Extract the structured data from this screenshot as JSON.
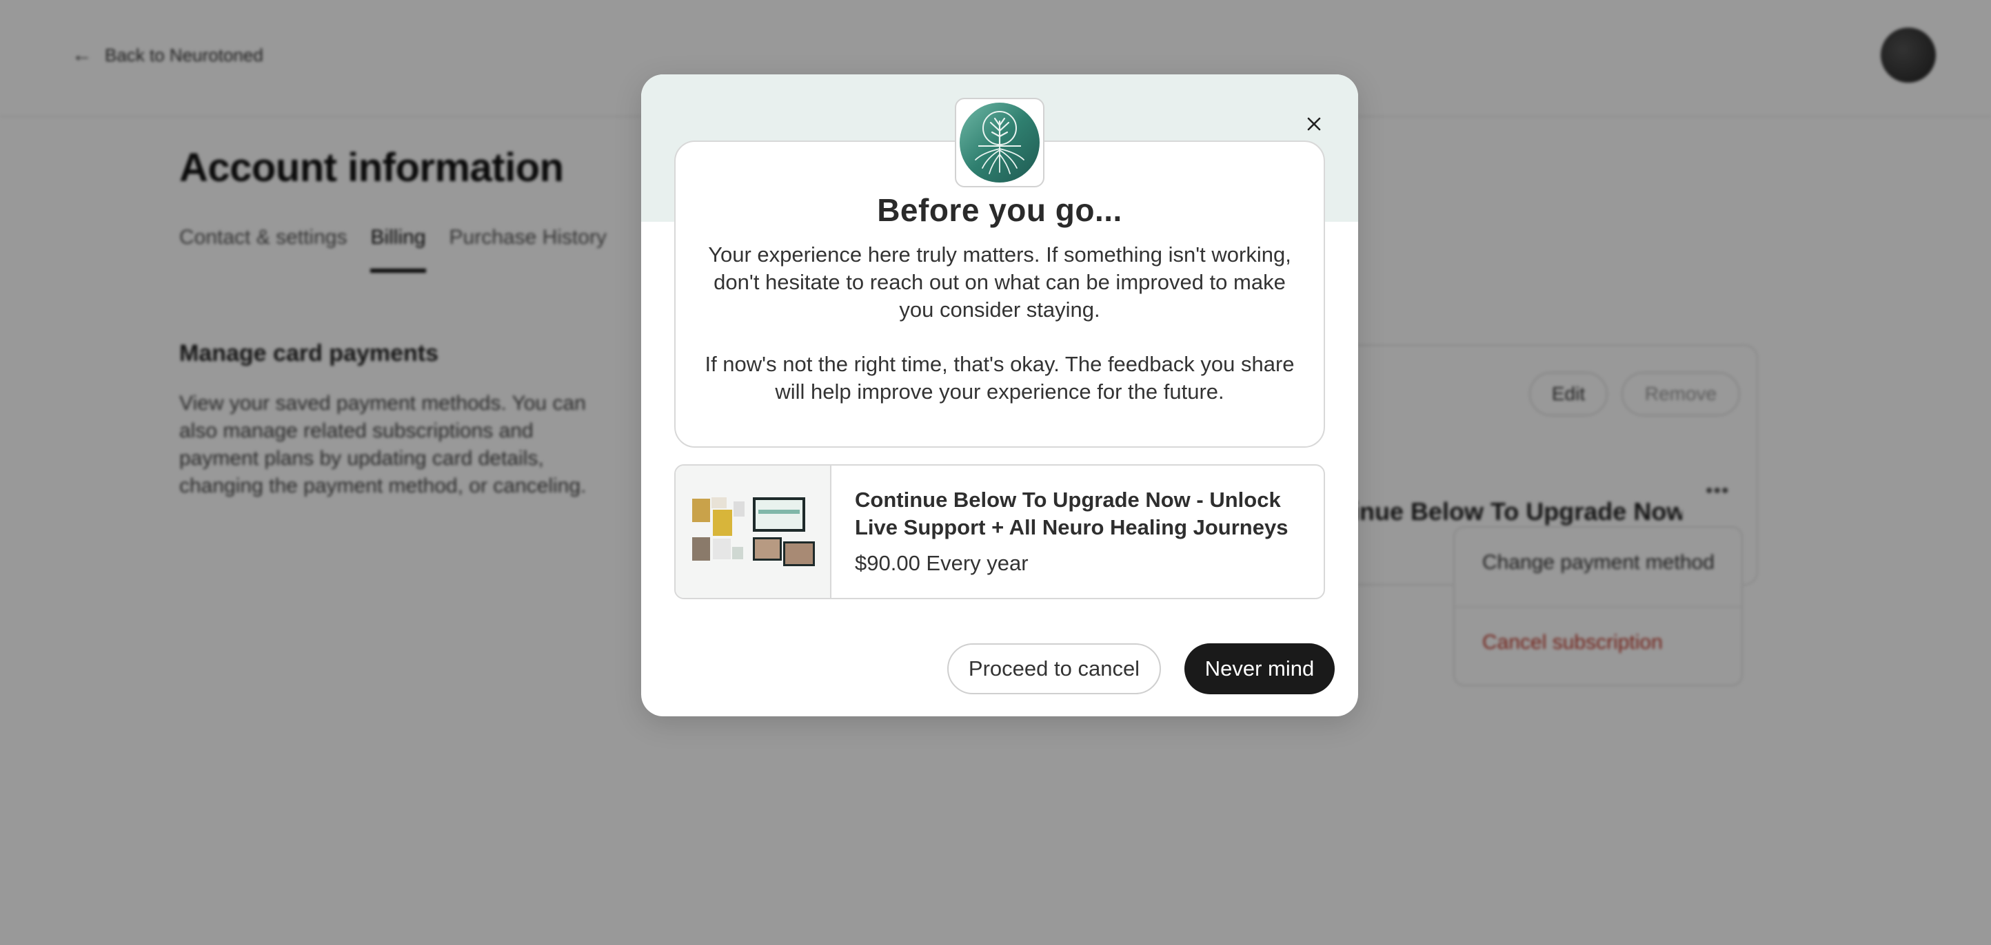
{
  "background": {
    "back_link": "Back to Neurotoned",
    "title": "Account information",
    "tabs": [
      {
        "label": "Contact & settings"
      },
      {
        "label": "Billing"
      },
      {
        "label": "Purchase History"
      }
    ],
    "active_tab": "Billing",
    "section_title": "Manage card payments",
    "section_desc": "View your saved payment methods. You can also manage related subscriptions and payment plans by updating card details, changing the payment method, or canceling.",
    "edit_label": "Edit",
    "remove_label": "Remove",
    "subscription_name": "Continue Below To Upgrade Now - Unlock Live Support + All Neuro Healing Journeys",
    "more_label": "•••",
    "menu": {
      "change_payment": "Change payment method",
      "cancel_subscription": "Cancel subscription"
    }
  },
  "modal": {
    "title": "Before you go...",
    "body_p1": "Your experience here truly matters. If something isn't working, don't hesitate to reach out on what can be improved to make you consider staying.",
    "body_p2": "If now's not the right time, that's okay. The feedback you share will help improve your experience for the future.",
    "offer": {
      "title": "Continue Below To Upgrade Now - Unlock Live Support + All Neuro Healing Journeys",
      "price": "$90.00 Every year"
    },
    "proceed_label": "Proceed to cancel",
    "nevermind_label": "Never mind"
  },
  "colors": {
    "modal_header_bg": "#e8f0ee",
    "primary_button": "#1a1a1a",
    "danger": "#c0392b",
    "overlay": "rgba(0,0,0,0.40)"
  },
  "icons": [
    "arrow-left-icon",
    "close-icon",
    "tree-logo-icon",
    "more-dots-icon"
  ]
}
